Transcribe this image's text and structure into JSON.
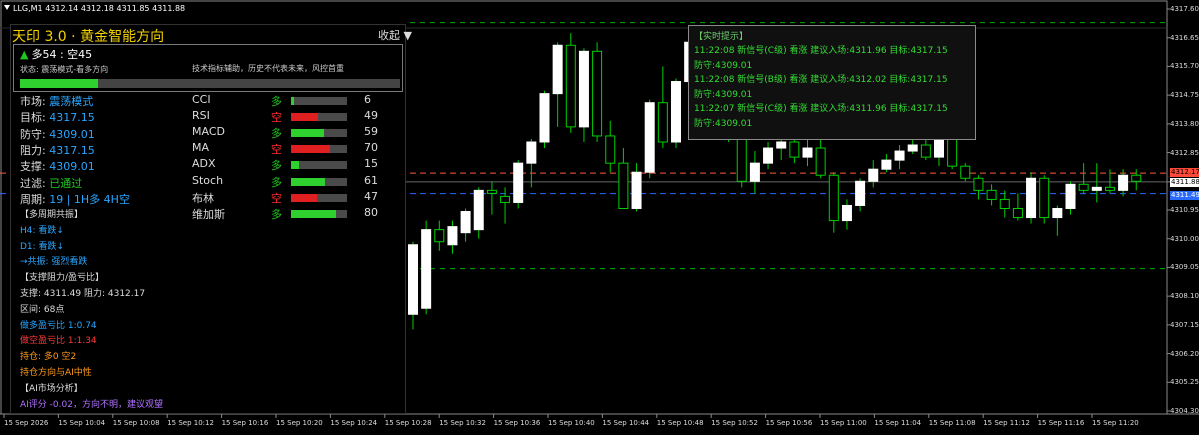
{
  "header": {
    "symbol_line": "LLG,M1  4312.14 4312.18 4311.85 4311.88"
  },
  "price_axis": {
    "labels": [
      "4317.60",
      "4316.65",
      "4315.70",
      "4314.75",
      "4313.80",
      "4312.85",
      "4311.88",
      "4310.95",
      "4310.00",
      "4309.05",
      "4308.10",
      "4307.15",
      "4306.20",
      "4305.25",
      "4304.30"
    ],
    "tag_red": "4312.17",
    "tag_current": "4311.88",
    "tag_blue": "4311.49"
  },
  "time_axis": {
    "labels": [
      "15 Sep 2026",
      "15 Sep 10:04",
      "15 Sep 10:08",
      "15 Sep 10:12",
      "15 Sep 10:16",
      "15 Sep 10:20",
      "15 Sep 10:24",
      "15 Sep 10:28",
      "15 Sep 10:32",
      "15 Sep 10:36",
      "15 Sep 10:40",
      "15 Sep 10:44",
      "15 Sep 10:48",
      "15 Sep 10:52",
      "15 Sep 10:56",
      "15 Sep 11:00",
      "15 Sep 11:04",
      "15 Sep 11:08",
      "15 Sep 11:12",
      "15 Sep 11:16",
      "15 Sep 11:20"
    ]
  },
  "candles": [
    {
      "o": 4307.5,
      "h": 4309.9,
      "l": 4307.0,
      "c": 4309.8
    },
    {
      "o": 4307.7,
      "h": 4310.6,
      "l": 4307.5,
      "c": 4310.3
    },
    {
      "o": 4310.3,
      "h": 4310.6,
      "l": 4309.6,
      "c": 4309.9
    },
    {
      "o": 4309.8,
      "h": 4310.6,
      "l": 4309.5,
      "c": 4310.4
    },
    {
      "o": 4310.2,
      "h": 4311.0,
      "l": 4309.9,
      "c": 4310.9
    },
    {
      "o": 4310.3,
      "h": 4311.7,
      "l": 4310.0,
      "c": 4311.6
    },
    {
      "o": 4311.6,
      "h": 4311.9,
      "l": 4310.8,
      "c": 4311.5
    },
    {
      "o": 4311.4,
      "h": 4311.7,
      "l": 4310.5,
      "c": 4311.2
    },
    {
      "o": 4311.2,
      "h": 4312.6,
      "l": 4311.0,
      "c": 4312.5
    },
    {
      "o": 4312.5,
      "h": 4313.3,
      "l": 4311.7,
      "c": 4313.2
    },
    {
      "o": 4313.2,
      "h": 4314.9,
      "l": 4313.0,
      "c": 4314.8
    },
    {
      "o": 4314.8,
      "h": 4316.5,
      "l": 4313.7,
      "c": 4316.4
    },
    {
      "o": 4316.4,
      "h": 4316.8,
      "l": 4313.5,
      "c": 4313.7
    },
    {
      "o": 4313.7,
      "h": 4316.3,
      "l": 4313.2,
      "c": 4316.2
    },
    {
      "o": 4316.2,
      "h": 4316.5,
      "l": 4313.2,
      "c": 4313.4
    },
    {
      "o": 4313.4,
      "h": 4313.9,
      "l": 4312.2,
      "c": 4312.5
    },
    {
      "o": 4312.5,
      "h": 4313.0,
      "l": 4311.0,
      "c": 4311.0
    },
    {
      "o": 4311.0,
      "h": 4312.5,
      "l": 4310.9,
      "c": 4312.2
    },
    {
      "o": 4312.2,
      "h": 4314.6,
      "l": 4312.0,
      "c": 4314.5
    },
    {
      "o": 4314.5,
      "h": 4315.7,
      "l": 4313.0,
      "c": 4313.2
    },
    {
      "o": 4313.2,
      "h": 4315.3,
      "l": 4313.0,
      "c": 4315.2
    },
    {
      "o": 4315.2,
      "h": 4316.9,
      "l": 4314.9,
      "c": 4316.5
    },
    {
      "o": 4316.5,
      "h": 4316.7,
      "l": 4314.2,
      "c": 4314.5
    },
    {
      "o": 4314.5,
      "h": 4315.0,
      "l": 4313.3,
      "c": 4313.7
    },
    {
      "o": 4313.7,
      "h": 4314.2,
      "l": 4313.2,
      "c": 4313.6
    },
    {
      "o": 4313.6,
      "h": 4314.3,
      "l": 4311.7,
      "c": 4311.9
    },
    {
      "o": 4311.9,
      "h": 4312.9,
      "l": 4311.5,
      "c": 4312.5
    },
    {
      "o": 4312.5,
      "h": 4313.2,
      "l": 4312.3,
      "c": 4313.0
    },
    {
      "o": 4313.0,
      "h": 4313.4,
      "l": 4312.6,
      "c": 4313.2
    },
    {
      "o": 4313.2,
      "h": 4313.9,
      "l": 4312.5,
      "c": 4312.7
    },
    {
      "o": 4312.7,
      "h": 4313.3,
      "l": 4312.4,
      "c": 4313.0
    },
    {
      "o": 4313.0,
      "h": 4313.5,
      "l": 4312.0,
      "c": 4312.1
    },
    {
      "o": 4312.1,
      "h": 4312.2,
      "l": 4310.2,
      "c": 4310.6
    },
    {
      "o": 4310.6,
      "h": 4311.3,
      "l": 4310.3,
      "c": 4311.1
    },
    {
      "o": 4311.1,
      "h": 4312.0,
      "l": 4310.9,
      "c": 4311.9
    },
    {
      "o": 4311.9,
      "h": 4312.6,
      "l": 4311.7,
      "c": 4312.3
    },
    {
      "o": 4312.3,
      "h": 4312.8,
      "l": 4312.2,
      "c": 4312.6
    },
    {
      "o": 4312.6,
      "h": 4313.1,
      "l": 4312.3,
      "c": 4312.9
    },
    {
      "o": 4312.9,
      "h": 4313.3,
      "l": 4312.8,
      "c": 4313.1
    },
    {
      "o": 4313.1,
      "h": 4313.5,
      "l": 4312.6,
      "c": 4312.7
    },
    {
      "o": 4312.7,
      "h": 4313.6,
      "l": 4312.4,
      "c": 4313.5
    },
    {
      "o": 4313.5,
      "h": 4313.8,
      "l": 4312.3,
      "c": 4312.4
    },
    {
      "o": 4312.4,
      "h": 4312.5,
      "l": 4311.9,
      "c": 4312.0
    },
    {
      "o": 4312.0,
      "h": 4312.1,
      "l": 4311.3,
      "c": 4311.6
    },
    {
      "o": 4311.6,
      "h": 4311.8,
      "l": 4311.1,
      "c": 4311.3
    },
    {
      "o": 4311.3,
      "h": 4311.6,
      "l": 4310.7,
      "c": 4311.0
    },
    {
      "o": 4311.0,
      "h": 4311.5,
      "l": 4310.6,
      "c": 4310.7
    },
    {
      "o": 4310.7,
      "h": 4312.2,
      "l": 4310.5,
      "c": 4312.0
    },
    {
      "o": 4312.0,
      "h": 4312.1,
      "l": 4310.5,
      "c": 4310.7
    },
    {
      "o": 4310.7,
      "h": 4311.1,
      "l": 4310.1,
      "c": 4311.0
    },
    {
      "o": 4311.0,
      "h": 4311.9,
      "l": 4310.8,
      "c": 4311.8
    },
    {
      "o": 4311.8,
      "h": 4312.5,
      "l": 4311.5,
      "c": 4311.6
    },
    {
      "o": 4311.6,
      "h": 4312.5,
      "l": 4311.2,
      "c": 4311.7
    },
    {
      "o": 4311.7,
      "h": 4312.3,
      "l": 4311.5,
      "c": 4311.6
    },
    {
      "o": 4311.6,
      "h": 4312.3,
      "l": 4311.4,
      "c": 4312.1
    },
    {
      "o": 4312.1,
      "h": 4312.3,
      "l": 4311.6,
      "c": 4311.9
    }
  ],
  "indicator": {
    "title": "天印 3.0 · 黄金智能方向",
    "collapse_label": "收起",
    "score": "多54 : 空45",
    "state": "状态: 震荡模式-看多方向",
    "disclaimer": "技术指标辅助，历史不代表未来，风控首重",
    "score_ratio": 0.54,
    "rows": [
      {
        "k": "市场:",
        "v": "震荡模式",
        "vcolor": "#2aa6ff"
      },
      {
        "k": "目标:",
        "v": "4317.15",
        "vcolor": "#2aa6ff"
      },
      {
        "k": "防守:",
        "v": "4309.01",
        "vcolor": "#2aa6ff"
      },
      {
        "k": "阻力:",
        "v": "4317.15",
        "vcolor": "#2aa6ff"
      },
      {
        "k": "支撑:",
        "v": "4309.01",
        "vcolor": "#2aa6ff"
      },
      {
        "k": "过滤:",
        "v": "已通过",
        "vcolor": "#1ec91e"
      },
      {
        "k": "周期:",
        "v": "19 | 1H多 4H空",
        "vcolor": "#2aa6ff"
      }
    ],
    "indicators": [
      {
        "name": "CCI",
        "dir": "多",
        "dir_color": "#1ec91e",
        "value": "6",
        "fill": 0.06,
        "bar_color": "#2ed12e"
      },
      {
        "name": "RSI",
        "dir": "空",
        "dir_color": "#ff2a2a",
        "value": "49",
        "fill": 0.49,
        "bar_color": "#e02020"
      },
      {
        "name": "MACD",
        "dir": "多",
        "dir_color": "#1ec91e",
        "value": "59",
        "fill": 0.59,
        "bar_color": "#2ed12e"
      },
      {
        "name": "MA",
        "dir": "空",
        "dir_color": "#ff2a2a",
        "value": "70",
        "fill": 0.7,
        "bar_color": "#e02020"
      },
      {
        "name": "ADX",
        "dir": "多",
        "dir_color": "#1ec91e",
        "value": "15",
        "fill": 0.15,
        "bar_color": "#2ed12e"
      },
      {
        "name": "Stoch",
        "dir": "多",
        "dir_color": "#1ec91e",
        "value": "61",
        "fill": 0.61,
        "bar_color": "#2ed12e"
      },
      {
        "name": "布林",
        "dir": "空",
        "dir_color": "#ff2a2a",
        "value": "47",
        "fill": 0.47,
        "bar_color": "#e02020"
      },
      {
        "name": "维加斯",
        "dir": "多",
        "dir_color": "#1ec91e",
        "value": "80",
        "fill": 0.8,
        "bar_color": "#2ed12e"
      }
    ],
    "sections": [
      {
        "t": "【多周期共振】",
        "c": "#dddddd"
      },
      {
        "t": "H4: 看跌↓",
        "c": "#2aa6ff"
      },
      {
        "t": "D1: 看跌↓",
        "c": "#2aa6ff"
      },
      {
        "t": "→共振: 强烈看跌",
        "c": "#2aa6ff"
      },
      {
        "t": "【支撑阻力/盈亏比】",
        "c": "#dddddd"
      },
      {
        "t": "支撑: 4311.49  阻力: 4312.17",
        "c": "#dddddd"
      },
      {
        "t": "区间: 68点",
        "c": "#dddddd"
      },
      {
        "t": "做多盈亏比 1:0.74",
        "c": "#2aa6ff"
      },
      {
        "t": "做空盈亏比 1:1.34",
        "c": "#ff3a3a"
      },
      {
        "t": "持仓: 多0 空2",
        "c": "#ff9a1a"
      },
      {
        "t": "持仓方向与AI中性",
        "c": "#ff9a1a"
      },
      {
        "t": "【AI市场分析】",
        "c": "#dddddd"
      },
      {
        "t": "AI评分 -0.02，方向不明，建议观望",
        "c": "#b070ff"
      }
    ]
  },
  "popup": {
    "title": "【实时提示】",
    "lines": [
      "11:22:08 新信号(C级) 看涨 建议入场:4311.96 目标:4317.15",
      "防守:4309.01",
      "11:22:08 新信号(B级) 看涨 建议入场:4312.02 目标:4317.15",
      "防守:4309.01",
      "11:22:07 新信号(C级) 看涨 建议入场:4311.96 目标:4317.15",
      "防守:4309.01"
    ]
  },
  "levels": {
    "resistance": 4312.17,
    "support": 4311.49,
    "target": 4317.15,
    "stop": 4309.01,
    "current": 4311.88
  },
  "colors": {
    "bull_candle": "#ffffff",
    "wick": "#00d000",
    "resistance": "#ff5a3c",
    "support": "#2a6aff",
    "stop": "#00b000"
  }
}
